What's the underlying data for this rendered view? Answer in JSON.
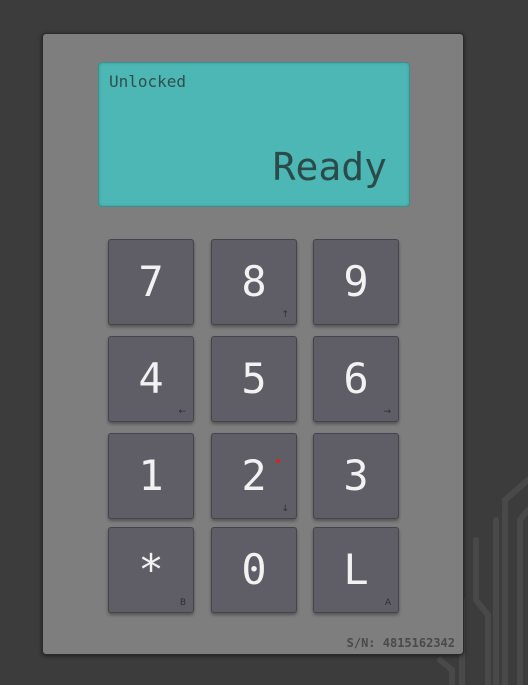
{
  "display": {
    "status": "Unlocked",
    "message": "Ready"
  },
  "keys": [
    {
      "label": "7",
      "sub": ""
    },
    {
      "label": "8",
      "sub": "↑"
    },
    {
      "label": "9",
      "sub": ""
    },
    {
      "label": "4",
      "sub": "←"
    },
    {
      "label": "5",
      "sub": ""
    },
    {
      "label": "6",
      "sub": "→"
    },
    {
      "label": "1",
      "sub": ""
    },
    {
      "label": "2",
      "sub": "↓"
    },
    {
      "label": "3",
      "sub": ""
    },
    {
      "label": "*",
      "sub": "B"
    },
    {
      "label": "0",
      "sub": ""
    },
    {
      "label": "L",
      "sub": "A"
    }
  ],
  "serial": "S/N: 4815162342",
  "colors": {
    "background": "#3c3c3c",
    "device": "#7e7e7e",
    "lcd": "#4cb7b4",
    "key": "#5f5e67",
    "indicator": "#e02020"
  }
}
